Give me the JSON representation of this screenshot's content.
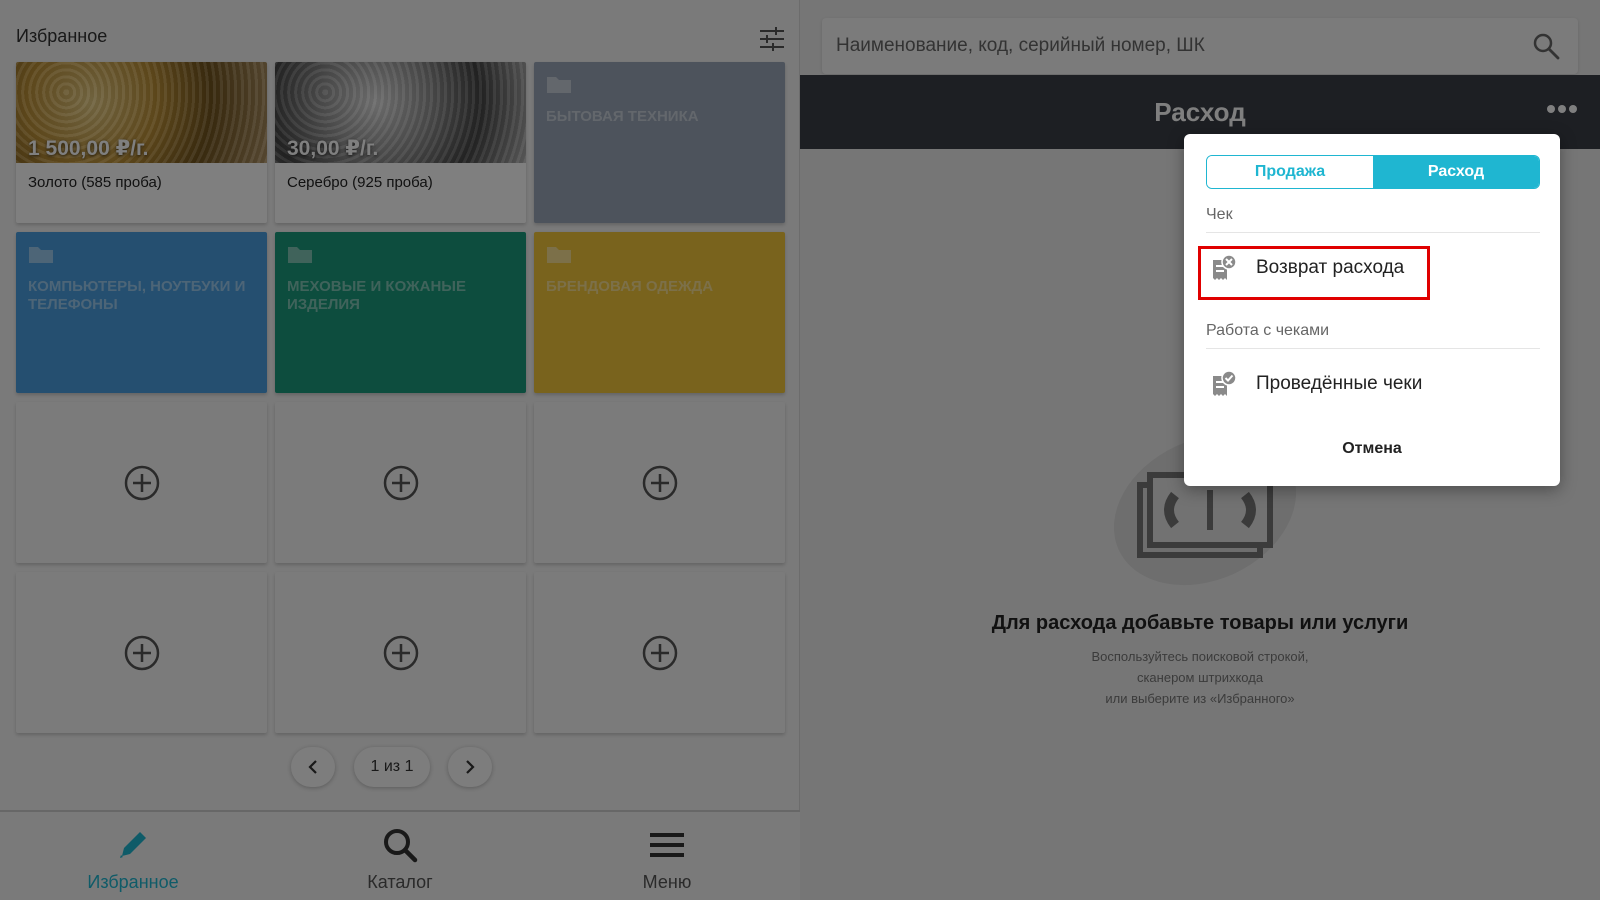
{
  "favorites": {
    "title": "Избранное",
    "products": [
      {
        "price": "1 500,00 ₽/г.",
        "name": "Золото (585 проба)"
      },
      {
        "price": "30,00 ₽/г.",
        "name": "Серебро (925 проба)"
      }
    ],
    "folders": [
      {
        "name": "БЫТОВАЯ ТЕХНИКА",
        "color": "#9aa7b8"
      },
      {
        "name": "КОМПЬЮТЕРЫ, НОУТБУКИ И ТЕЛЕФОНЫ",
        "color": "#4a9fe0"
      },
      {
        "name": "МЕХОВЫЕ И КОЖАНЫЕ ИЗДЕЛИЯ",
        "color": "#1a9a7d"
      },
      {
        "name": "БРЕНДОВАЯ ОДЕЖДА",
        "color": "#f2c63b"
      }
    ],
    "pager": {
      "label": "1 из 1"
    }
  },
  "bottom_nav": {
    "items": [
      {
        "label": "Избранное",
        "icon": "pencil-icon",
        "active": true
      },
      {
        "label": "Каталог",
        "icon": "search-icon",
        "active": false
      },
      {
        "label": "Меню",
        "icon": "hamburger-icon",
        "active": false
      }
    ]
  },
  "right": {
    "search_placeholder": "Наименование, код, серийный номер, ШК",
    "header_title": "Расход",
    "empty_title": "Для расхода добавьте товары или услуги",
    "empty_hint": [
      "Воспользуйтесь поисковой строкой,",
      "сканером штрихкода",
      "или выберите из «Избранного»"
    ]
  },
  "popup": {
    "segments": [
      {
        "label": "Продажа",
        "active": false
      },
      {
        "label": "Расход",
        "active": true
      }
    ],
    "section_check": "Чек",
    "return_item": "Возврат расхода",
    "section_work": "Работа с чеками",
    "receipts_item": "Проведённые чеки",
    "cancel": "Отмена"
  },
  "colors": {
    "accent": "#1fb6d1",
    "header": "#3a3f47",
    "highlight": "#e00000"
  }
}
